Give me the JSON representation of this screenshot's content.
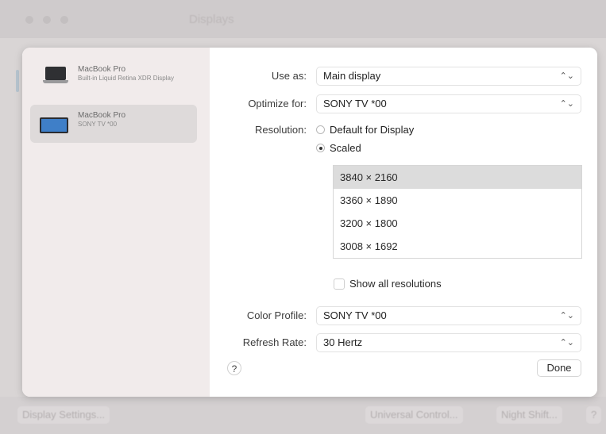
{
  "background": {
    "title": "Displays",
    "bottom_buttons": [
      "Display Settings...",
      "Universal Control...",
      "Night Shift...",
      "?"
    ]
  },
  "sidebar": {
    "items": [
      {
        "name": "MacBook Pro",
        "sub": "Built-in Liquid Retina XDR Display",
        "icon": "laptop-icon",
        "selected": false
      },
      {
        "name": "MacBook Pro",
        "sub": "SONY TV *00",
        "icon": "display-icon",
        "selected": true
      }
    ]
  },
  "settings": {
    "use_as": {
      "label": "Use as:",
      "value": "Main display"
    },
    "optimize_for": {
      "label": "Optimize for:",
      "value": "SONY TV *00"
    },
    "resolution": {
      "label": "Resolution:",
      "options": [
        {
          "label": "Default for Display",
          "selected": false
        },
        {
          "label": "Scaled",
          "selected": true
        }
      ],
      "list": [
        "3840 × 2160",
        "3360 × 1890",
        "3200 × 1800",
        "3008 × 1692"
      ],
      "selected_index": 0,
      "show_all_label": "Show all resolutions"
    },
    "color_profile": {
      "label": "Color Profile:",
      "value": "SONY TV *00"
    },
    "refresh_rate": {
      "label": "Refresh Rate:",
      "value": "30 Hertz"
    }
  },
  "footer": {
    "help_label": "?",
    "done_label": "Done"
  },
  "chevron": "⌃⌄"
}
